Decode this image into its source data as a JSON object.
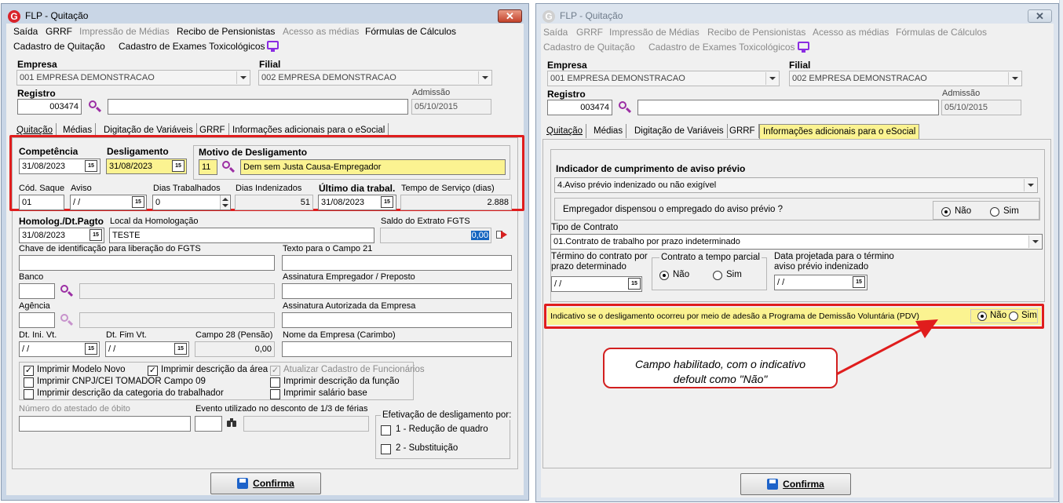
{
  "left": {
    "title": "FLP - Quitação",
    "close": "✕",
    "menu": [
      "Saída",
      "GRRF",
      "Impressão de Médias",
      "Recibo de Pensionistas",
      "Acesso as médias",
      "Fórmulas de Cálculos"
    ],
    "menu2": [
      "Cadastro de Quitação",
      "Cadastro de Exames Toxicológicos"
    ],
    "empresa_label": "Empresa",
    "empresa_value": "001 EMPRESA DEMONSTRACAO",
    "filial_label": "Filial",
    "filial_value": "002 EMPRESA DEMONSTRACAO",
    "registro_label": "Registro",
    "registro_value": "003474",
    "admissao_label": "Admissão",
    "admissao_value": "05/10/2015",
    "tabs": [
      "Quitação",
      "Médias",
      "Digitação de Variáveis",
      "GRRF",
      "Informações adicionais para o eSocial"
    ],
    "competencia_label": "Competência",
    "competencia_value": "31/08/2023",
    "desligamento_label": "Desligamento",
    "desligamento_value": "31/08/2023",
    "motivo_label": "Motivo de Desligamento",
    "motivo_code": "11",
    "motivo_desc": "Dem sem Justa Causa-Empregador",
    "cod_saque_label": "Cód. Saque",
    "cod_saque_value": "01",
    "aviso_label": "Aviso",
    "aviso_value": " / /",
    "dias_trab_label": "Dias Trabalhados",
    "dias_trab_value": "0",
    "dias_indeniz_label": "Dias Indenizados",
    "dias_indeniz_value": "51",
    "ultimo_dia_label": "Último dia trabal.",
    "ultimo_dia_value": "31/08/2023",
    "tempo_servico_label": "Tempo de Serviço (dias)",
    "tempo_servico_value": "2.888",
    "homolog_label": "Homolog./Dt.Pagto",
    "homolog_value": "31/08/2023",
    "local_homolog_label": "Local da Homologação",
    "local_homolog_value": "TESTE",
    "saldo_fgts_label": "Saldo do Extrato FGTS",
    "saldo_fgts_value": "0,00",
    "chave_label": "Chave de identificação para liberação do FGTS",
    "texto21_label": "Texto para o Campo 21",
    "banco_label": "Banco",
    "assin_emp_label": "Assinatura Empregador / Preposto",
    "agencia_label": "Agência",
    "assin_aut_label": "Assinatura Autorizada da Empresa",
    "dt_ini_label": "Dt. Ini. Vt.",
    "dt_ini_value": " / /",
    "dt_fim_label": "Dt. Fim Vt.",
    "dt_fim_value": " / /",
    "campo28_label": "Campo 28 (Pensão)",
    "campo28_value": "0,00",
    "nome_empresa_label": "Nome da Empresa (Carimbo)",
    "checks": {
      "modelo_novo": "Imprimir Modelo Novo",
      "desc_area": "Imprimir descrição da área",
      "atualizar": "Atualizar Cadastro de Funcionários",
      "cnpj": "Imprimir CNPJ/CEI TOMADOR Campo 09",
      "desc_funcao": "Imprimir descrição da função",
      "desc_categoria": "Imprimir descrição da categoria do trabalhador",
      "salario_base": "Imprimir salário base"
    },
    "atestado_label": "Número do atestado de óbito",
    "evento_label": "Evento utilizado no desconto de 1/3 de férias",
    "efetivacao_label": "Efetivação de desligamento por:",
    "efetivacao_opt1": "1 - Redução de quadro",
    "efetivacao_opt2": "2 - Substituição",
    "confirm": "Confirma"
  },
  "right": {
    "title": "FLP - Quitação",
    "close": "✕",
    "indicador_label": "Indicador de cumprimento de aviso prévio",
    "indicador_value": "4.Aviso prévio indenizado ou não exigível",
    "dispensou_label": "Empregador dispensou o empregado do aviso prévio ?",
    "nao": "Não",
    "sim": "Sim",
    "tipo_contrato_label": "Tipo de Contrato",
    "tipo_contrato_value": "01.Contrato de trabalho por prazo indeterminado",
    "termino_label_1": "Término do contrato por",
    "termino_label_2": "prazo determinado",
    "termino_value": " / /",
    "parcial_label": "Contrato a tempo parcial",
    "data_proj_label_1": "Data projetada para o término",
    "data_proj_label_2": "aviso prévio indenizado",
    "data_proj_value": " / /",
    "pdv_label": "Indicativo se o desligamento ocorreu por meio de adesão a Programa de Demissão Voluntária (PDV)",
    "callout_line1": "Campo habilitado, com o indicativo",
    "callout_line2": "defoult como \"Não\"",
    "confirm": "Confirma"
  },
  "icons": {
    "calendar": "15"
  }
}
